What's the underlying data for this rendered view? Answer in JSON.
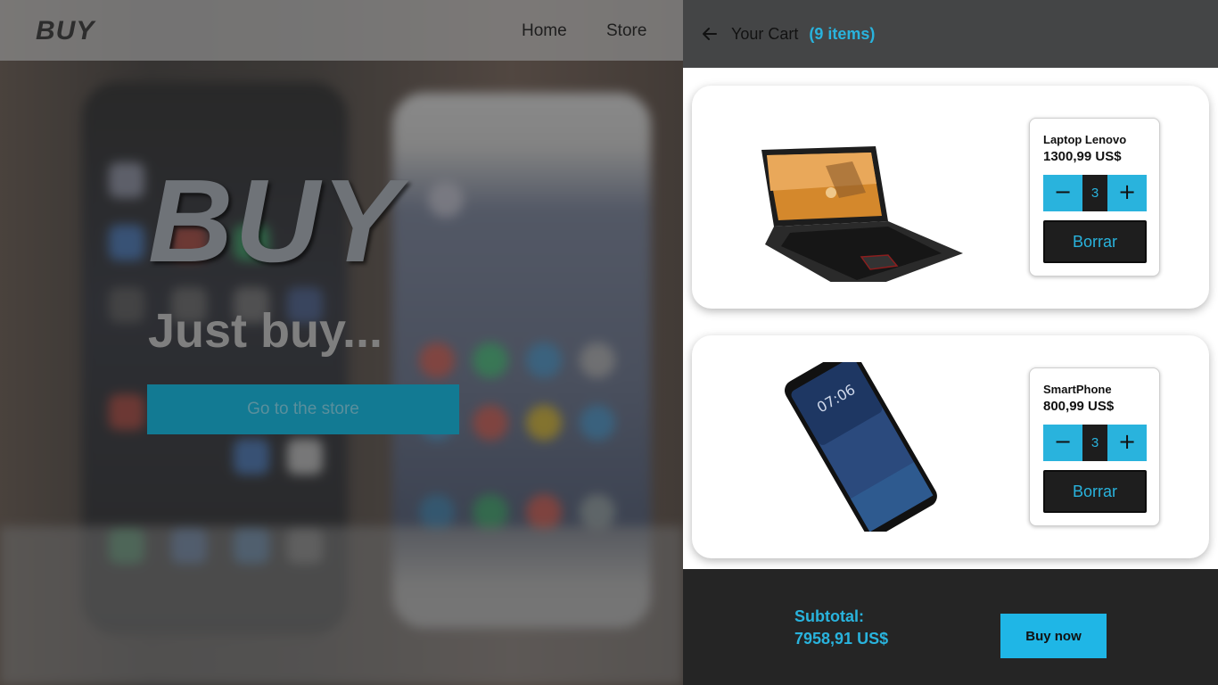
{
  "nav": {
    "brand": "BUY",
    "links": [
      "Home",
      "Store"
    ]
  },
  "hero": {
    "title": "BUY",
    "subtitle": "Just buy...",
    "cta_label": "Go to the store"
  },
  "cart": {
    "title": "Your Cart",
    "count_label": "(9 items)",
    "items": [
      {
        "name": "Laptop Lenovo",
        "price": "1300,99 US$",
        "quantity": "3",
        "delete_label": "Borrar",
        "image_icon": "laptop-image"
      },
      {
        "name": "SmartPhone",
        "price": "800,99 US$",
        "quantity": "3",
        "delete_label": "Borrar",
        "image_icon": "smartphone-image"
      }
    ],
    "subtotal_label": "Subtotal:",
    "subtotal_value": "7958,91 US$",
    "buy_label": "Buy now",
    "phone_clock": "07:06"
  },
  "colors": {
    "accent": "#29b3dd",
    "header_bg": "#444546",
    "footer_bg": "#252525",
    "button_dark": "#1e1e1e",
    "cta_bg": "#127a93"
  }
}
